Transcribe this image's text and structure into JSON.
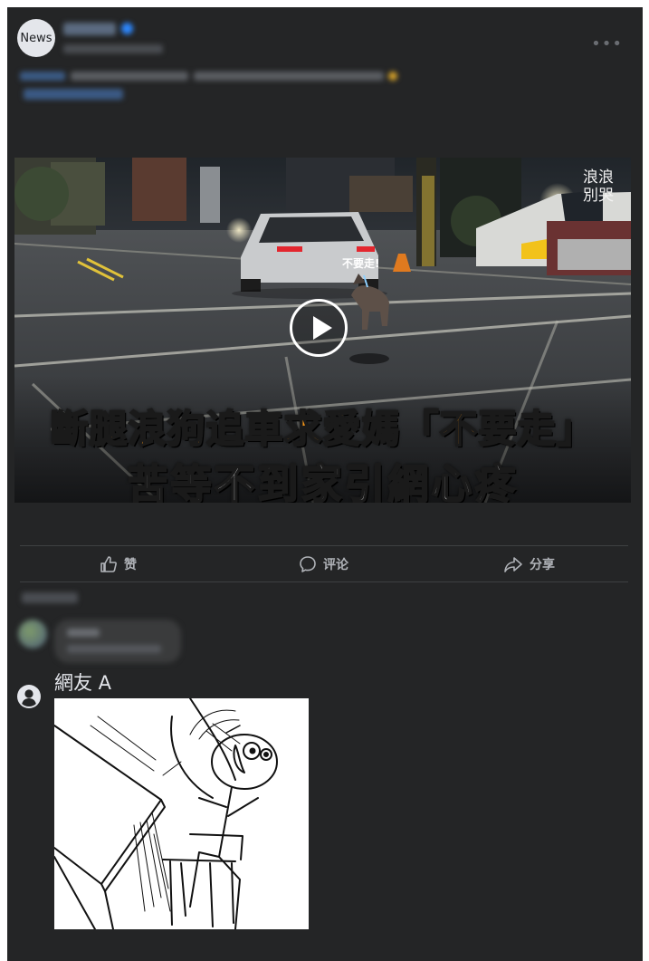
{
  "post": {
    "page_avatar_label": "News",
    "more_icon": "more-horizontal-icon"
  },
  "video": {
    "watermark": "浪浪\n別哭",
    "dog_label": "不要走!",
    "caption_line1": "斷腿浪狗追車求愛媽「不要走」",
    "caption_line2": "苦等不到家引網心疼",
    "play_icon": "play-icon"
  },
  "actions": {
    "like_label": "赞",
    "like_icon": "thumbs-up-icon",
    "comment_label": "评论",
    "comment_icon": "comment-bubble-icon",
    "share_label": "分享",
    "share_icon": "share-arrow-icon"
  },
  "comment": {
    "username": "網友 A",
    "avatar_icon": "user-circle-icon"
  },
  "colors": {
    "card_background": "#242526",
    "caption_orange": "#f39418",
    "action_text": "#b0b3b8"
  }
}
